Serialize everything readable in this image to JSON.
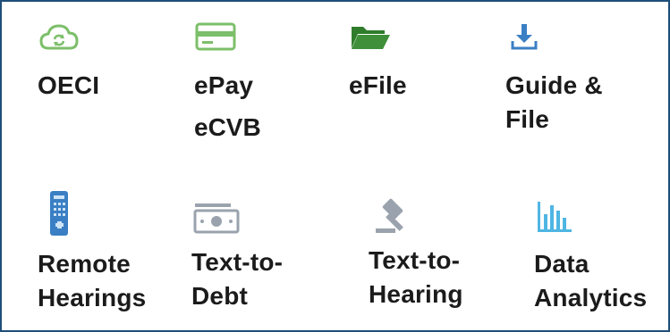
{
  "services": {
    "row1": [
      {
        "id": "oeci",
        "label": "OECI",
        "icon": "cloud-sync-icon",
        "color": "#7cbf6a"
      },
      {
        "id": "epay",
        "label": "ePay",
        "extra": "eCVB",
        "icon": "credit-card-icon",
        "color": "#7cbf6a"
      },
      {
        "id": "efile",
        "label": "eFile",
        "icon": "folder-open-icon",
        "color": "#3f8f3a"
      },
      {
        "id": "guide",
        "label_line1": "Guide &",
        "label_line2": "File",
        "icon": "download-icon",
        "color": "#3a7fc4"
      }
    ],
    "row2": [
      {
        "id": "remote",
        "label_line1": "Remote",
        "label_line2": "Hearings",
        "icon": "remote-control-icon",
        "color": "#3a7fc4"
      },
      {
        "id": "text-debt",
        "label_line1": "Text-to-",
        "label_line2": "Debt",
        "icon": "money-icon",
        "color": "#9aa3ad"
      },
      {
        "id": "text-hearing",
        "label_line1": "Text-to-",
        "label_line2": "Hearing",
        "icon": "gavel-icon",
        "color": "#9aa3ad"
      },
      {
        "id": "analytics",
        "label_line1": "Data",
        "label_line2": "Analytics",
        "icon": "bar-chart-icon",
        "color": "#4fb6e3"
      }
    ]
  }
}
